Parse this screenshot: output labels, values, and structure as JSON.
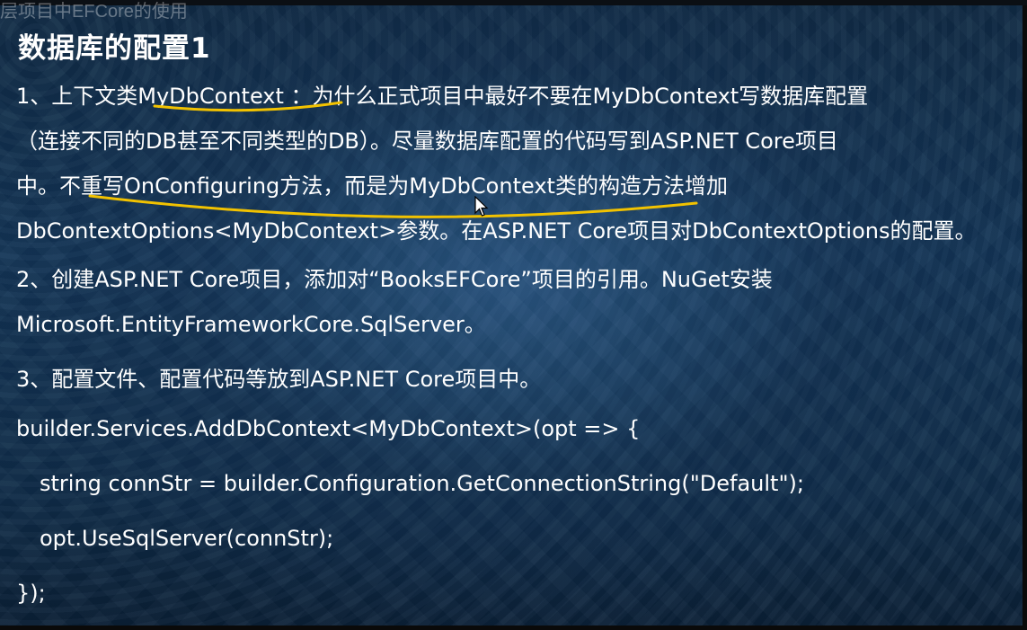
{
  "window": {
    "video_title": "层项目中EFCore的使用"
  },
  "slide": {
    "title": "数据库的配置1",
    "p1": {
      "line1": "1、上下文类MyDbContext ：为什么正式项目中最好不要在MyDbContext写数据库配置",
      "line2": "（连接不同的DB甚至不同类型的DB）。尽量数据库配置的代码写到ASP.NET Core项目",
      "line3": "中。不重写OnConfiguring方法，而是为MyDbContext类的构造方法增加",
      "line4": "DbContextOptions<MyDbContext>参数。在ASP.NET Core项目对DbContextOptions的配置。"
    },
    "p2": {
      "line1": "2、创建ASP.NET Core项目，添加对“BooksEFCore”项目的引用。NuGet安装",
      "line2": "Microsoft.EntityFrameworkCore.SqlServer。"
    },
    "p3": {
      "line1": "3、配置文件、配置代码等放到ASP.NET Core项目中。"
    },
    "code": {
      "line1": "builder.Services.AddDbContext<MyDbContext>(opt => {",
      "line2": "string connStr = builder.Configuration.GetConnectionString(\"Default\");",
      "line3": "opt.UseSqlServer(connStr);",
      "line4": "});"
    },
    "annotation_color": "#f2c200",
    "cursor_icon": "arrow-cursor-icon"
  }
}
